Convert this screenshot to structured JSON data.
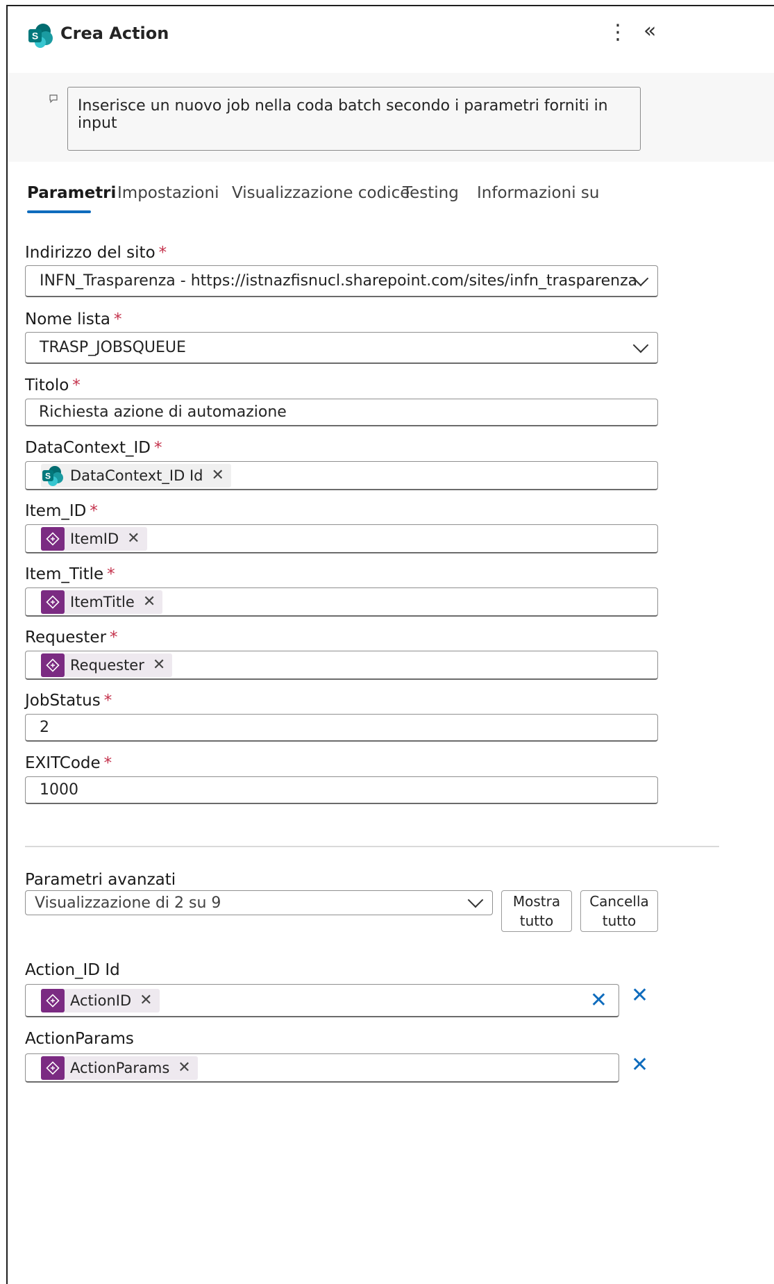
{
  "header": {
    "title": "Crea Action",
    "logo_icon": "sharepoint-icon",
    "more_icon": "more-vertical-icon",
    "collapse_icon": "collapse-chevrons-icon",
    "more_glyph": "⋮",
    "collapse_glyph": "«"
  },
  "description": {
    "icon": "comment-icon",
    "text": "Inserisce un nuovo job nella coda batch secondo i parametri forniti in input"
  },
  "tabs": [
    {
      "label": "Parametri",
      "active": true
    },
    {
      "label": "Impostazioni",
      "active": false
    },
    {
      "label": "Visualizzazione codice",
      "active": false
    },
    {
      "label": "Testing",
      "active": false
    },
    {
      "label": "Informazioni su",
      "active": false
    }
  ],
  "required_marker": "*",
  "fields": {
    "site": {
      "label": "Indirizzo del sito",
      "value": "INFN_Trasparenza - https://istnazfisnucl.sharepoint.com/sites/infn_trasparenza"
    },
    "list": {
      "label": "Nome lista",
      "value": "TRASP_JOBSQUEUE"
    },
    "title": {
      "label": "Titolo",
      "value": "Richiesta azione di automazione"
    },
    "datacontext": {
      "label": "DataContext_ID",
      "token": "DataContext_ID Id",
      "token_icon": "sharepoint-icon"
    },
    "item_id": {
      "label": "Item_ID",
      "token": "ItemID",
      "token_icon": "powerapps-icon"
    },
    "item_title": {
      "label": "Item_Title",
      "token": "ItemTitle",
      "token_icon": "powerapps-icon"
    },
    "requester": {
      "label": "Requester",
      "token": "Requester",
      "token_icon": "powerapps-icon"
    },
    "jobstatus": {
      "label": "JobStatus",
      "value": "2"
    },
    "exitcode": {
      "label": "EXITCode",
      "value": "1000"
    }
  },
  "advanced": {
    "label": "Parametri avanzati",
    "select_value": "Visualizzazione di 2 su 9",
    "show_all_line1": "Mostra",
    "show_all_line2": "tutto",
    "clear_all_line1": "Cancella",
    "clear_all_line2": "tutto"
  },
  "advanced_fields": {
    "action_id": {
      "label": "Action_ID Id",
      "token": "ActionID",
      "token_icon": "powerapps-icon"
    },
    "action_params": {
      "label": "ActionParams",
      "token": "ActionParams",
      "token_icon": "powerapps-icon"
    }
  },
  "glyphs": {
    "token_remove": "✕",
    "clear_x": "✕"
  },
  "colors": {
    "accent": "#0f6cbd",
    "required": "#c4314b",
    "token_icon_bg": "#7b2b82",
    "sharepoint_teal": "#038387"
  }
}
